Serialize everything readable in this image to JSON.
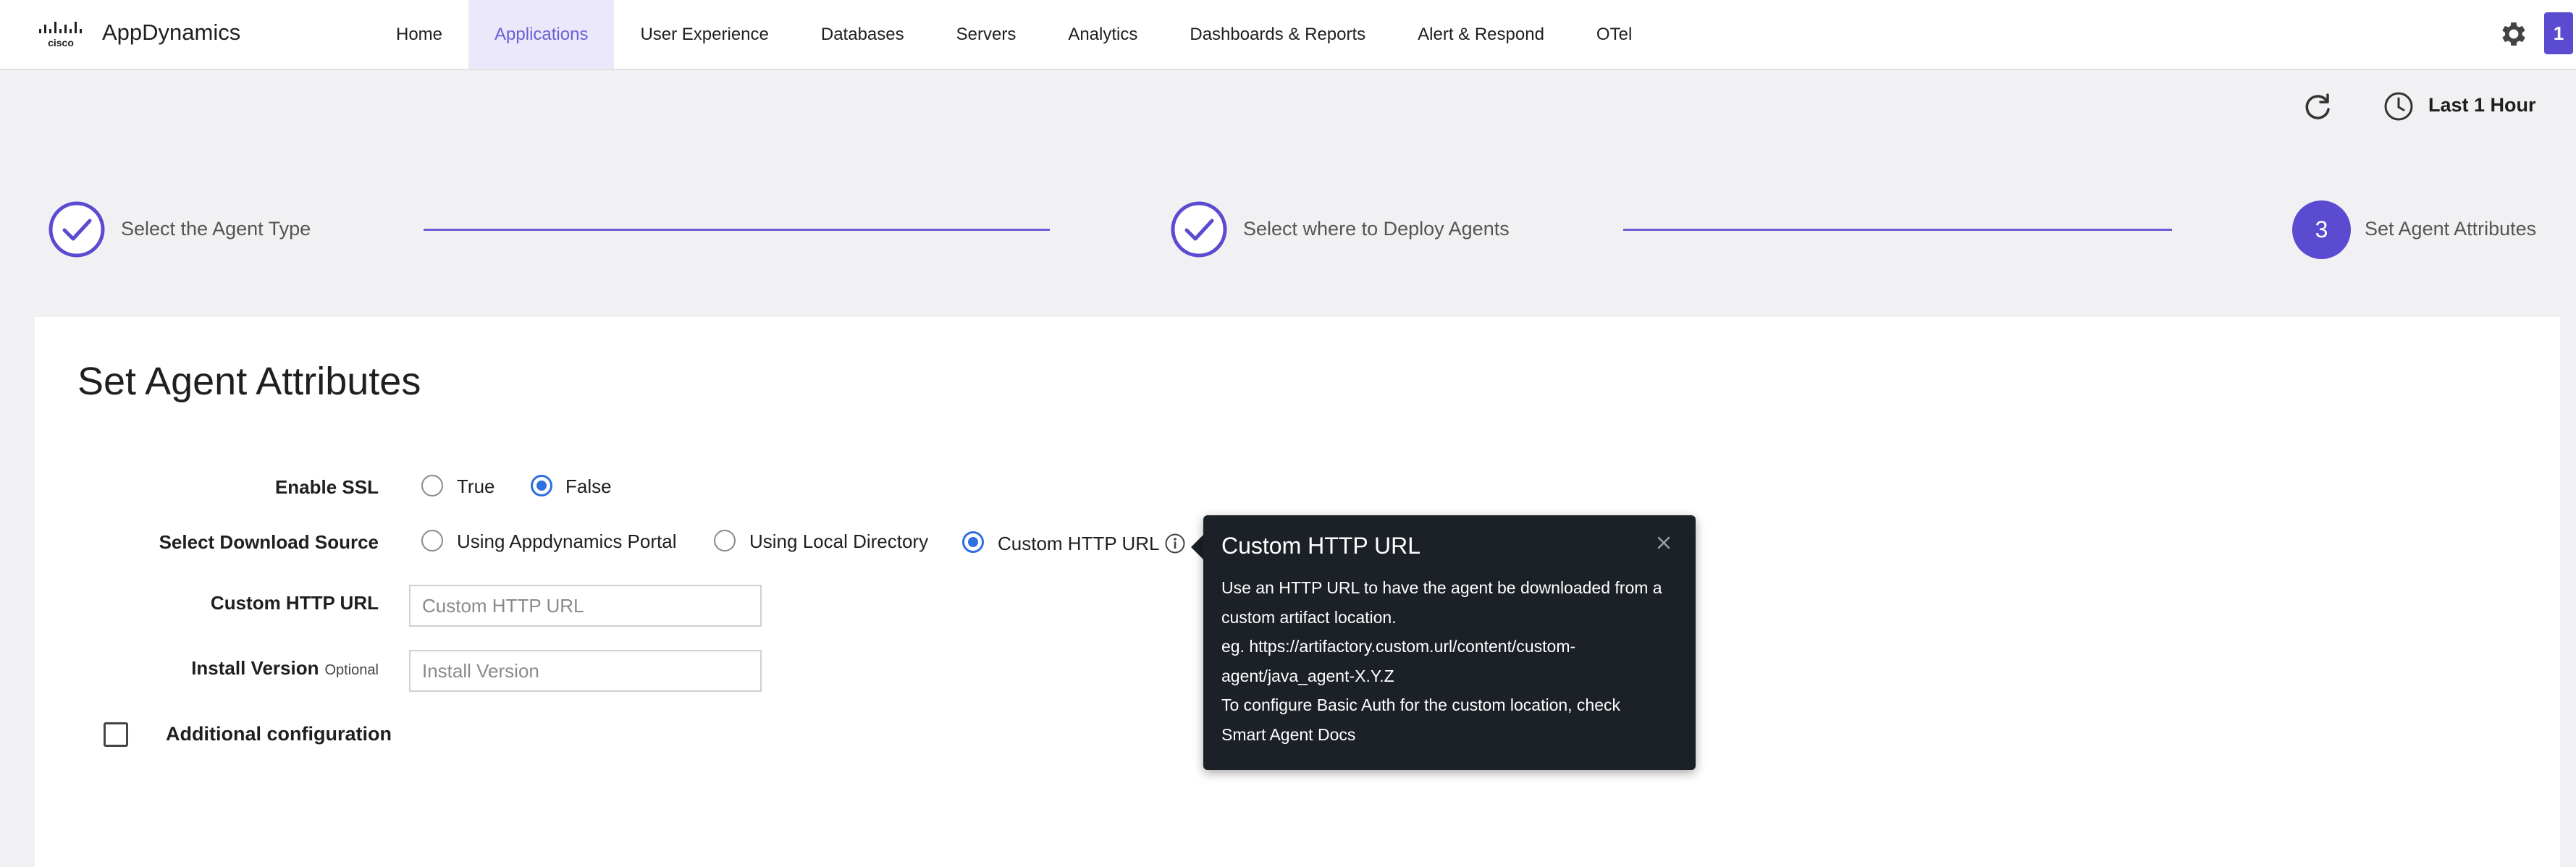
{
  "app": {
    "brand": "AppDynamics",
    "logo_text": "cisco",
    "notification_count": "1"
  },
  "nav": {
    "items": [
      {
        "label": "Home",
        "active": false
      },
      {
        "label": "Applications",
        "active": true
      },
      {
        "label": "User Experience",
        "active": false
      },
      {
        "label": "Databases",
        "active": false
      },
      {
        "label": "Servers",
        "active": false
      },
      {
        "label": "Analytics",
        "active": false
      },
      {
        "label": "Dashboards & Reports",
        "active": false
      },
      {
        "label": "Alert & Respond",
        "active": false
      },
      {
        "label": "OTel",
        "active": false
      }
    ]
  },
  "time_range": {
    "label": "Last 1 Hour"
  },
  "stepper": {
    "steps": [
      {
        "label": "Select the Agent Type",
        "state": "completed"
      },
      {
        "label": "Select where to Deploy Agents",
        "state": "completed"
      },
      {
        "number": "3",
        "label": "Set Agent Attributes",
        "state": "current"
      }
    ]
  },
  "form": {
    "title": "Set Agent Attributes",
    "enable_ssl": {
      "label": "Enable SSL",
      "options": [
        "True",
        "False"
      ],
      "selected": "False"
    },
    "download_source": {
      "label": "Select Download Source",
      "options": [
        "Using Appdynamics Portal",
        "Using Local Directory",
        "Custom HTTP URL"
      ],
      "selected": "Custom HTTP URL"
    },
    "custom_http_url": {
      "label": "Custom HTTP URL",
      "value": "",
      "placeholder": "Custom HTTP URL"
    },
    "install_version": {
      "label": "Install Version",
      "optional_label": "Optional",
      "value": "",
      "placeholder": "Install Version"
    },
    "additional_config": {
      "label": "Additional configuration",
      "checked": false
    }
  },
  "tooltip": {
    "title": "Custom HTTP URL",
    "lines": [
      "Use an HTTP URL to have the agent be downloaded from a",
      "custom artifact location.",
      "eg. https://artifactory.custom.url/content/custom-",
      "agent/java_agent-X.Y.Z",
      "To configure Basic Auth for the custom location, check",
      "Smart Agent Docs"
    ]
  },
  "colors": {
    "accent": "#5a4bd0",
    "nav_active_bg": "#ebe8fb",
    "nav_active_text": "#6b5fd3",
    "radio_selected": "#2f6fdf",
    "tooltip_bg": "#1c2027"
  },
  "icons": [
    "cisco-logo",
    "gear-icon",
    "refresh-icon",
    "clock-icon",
    "check-circle-icon",
    "info-icon",
    "close-icon"
  ]
}
